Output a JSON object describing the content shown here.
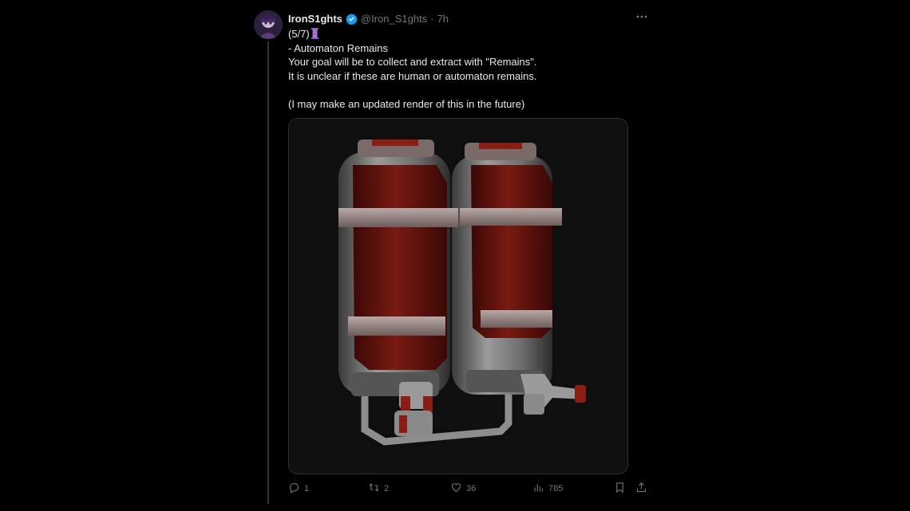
{
  "tweet": {
    "display_name": "IronS1ghts",
    "handle": "@Iron_S1ghts",
    "separator": "·",
    "time": "7h",
    "lines": [
      "(5/7)",
      "- Automaton Remains",
      "Your goal will be to collect and extract with \"Remains\".",
      "It is unclear if these are human or automaton remains.",
      "",
      "(I may make an updated render of this in the future)"
    ],
    "media_icon": "image-twin-red-tanks"
  },
  "actions": {
    "replies": "1",
    "reposts": "2",
    "likes": "36",
    "views": "785"
  },
  "icons": {
    "verified": "verified-badge-icon",
    "more": "more-icon",
    "thread_marker": "spool-icon",
    "reply": "reply-icon",
    "repost": "repost-icon",
    "like": "like-icon",
    "views": "views-icon",
    "bookmark": "bookmark-icon",
    "share": "share-icon"
  },
  "colors": {
    "background": "#000000",
    "text": "#e7e9ea",
    "muted": "#71767b",
    "verified": "#1d9bf0",
    "tank_red": "#6e1510"
  }
}
